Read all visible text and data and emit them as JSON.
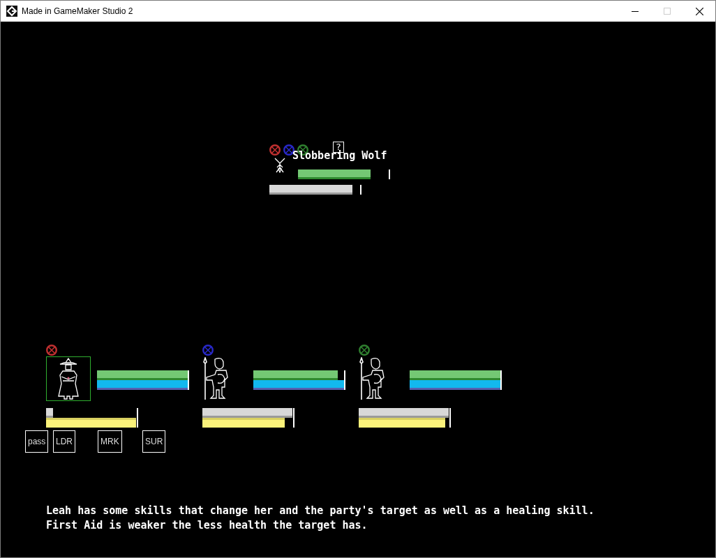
{
  "window": {
    "title": "Made in GameMaker Studio 2",
    "maximize_disabled": true
  },
  "enemy": {
    "name": "Slobbering Wolf",
    "status_glyph": "?",
    "health": {
      "level": 0.8
    },
    "stamina": {
      "level": 0.915
    },
    "target_marks": [
      {
        "color": "#c03030"
      },
      {
        "color": "#2828c8"
      },
      {
        "color": "#2f7f2f"
      }
    ]
  },
  "party": [
    {
      "kind": "cloaked",
      "selected": true,
      "mark": {
        "color": "#c03030"
      },
      "health": {
        "level": 1.0
      },
      "mana": {
        "level": 1.0
      },
      "stamina": {
        "level": 0.08
      },
      "action": {
        "level": 0.99
      }
    },
    {
      "kind": "spear",
      "selected": false,
      "mark": {
        "color": "#2828c8"
      },
      "health": {
        "level": 0.93
      },
      "mana": {
        "level": 1.0
      },
      "stamina": {
        "level": 0.99
      },
      "action": {
        "level": 0.91
      }
    },
    {
      "kind": "spear",
      "selected": false,
      "mark": {
        "color": "#2f7f2f"
      },
      "health": {
        "level": 1.0
      },
      "mana": {
        "level": 1.0
      },
      "stamina": {
        "level": 0.99
      },
      "action": {
        "level": 0.95
      }
    }
  ],
  "skills": [
    "pass",
    "LDR",
    "MRK",
    "SUR"
  ],
  "message": [
    "Leah has some skills that change her and the party's target as well as a healing skill.",
    "First Aid is weaker the less health the target has."
  ]
}
